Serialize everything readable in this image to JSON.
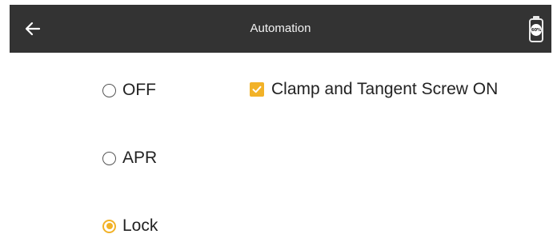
{
  "header": {
    "title": "Automation",
    "back_icon": "arrow-left-icon",
    "battery_level": "60%",
    "background_color": "#333333"
  },
  "modes": {
    "selected": "Lock",
    "options": [
      {
        "label": "OFF",
        "checked": false
      },
      {
        "label": "APR",
        "checked": false
      },
      {
        "label": "Lock",
        "checked": true
      }
    ],
    "accent_color": "#f2b228"
  },
  "clamp_option": {
    "label": "Clamp and Tangent Screw ON",
    "checked": true
  }
}
